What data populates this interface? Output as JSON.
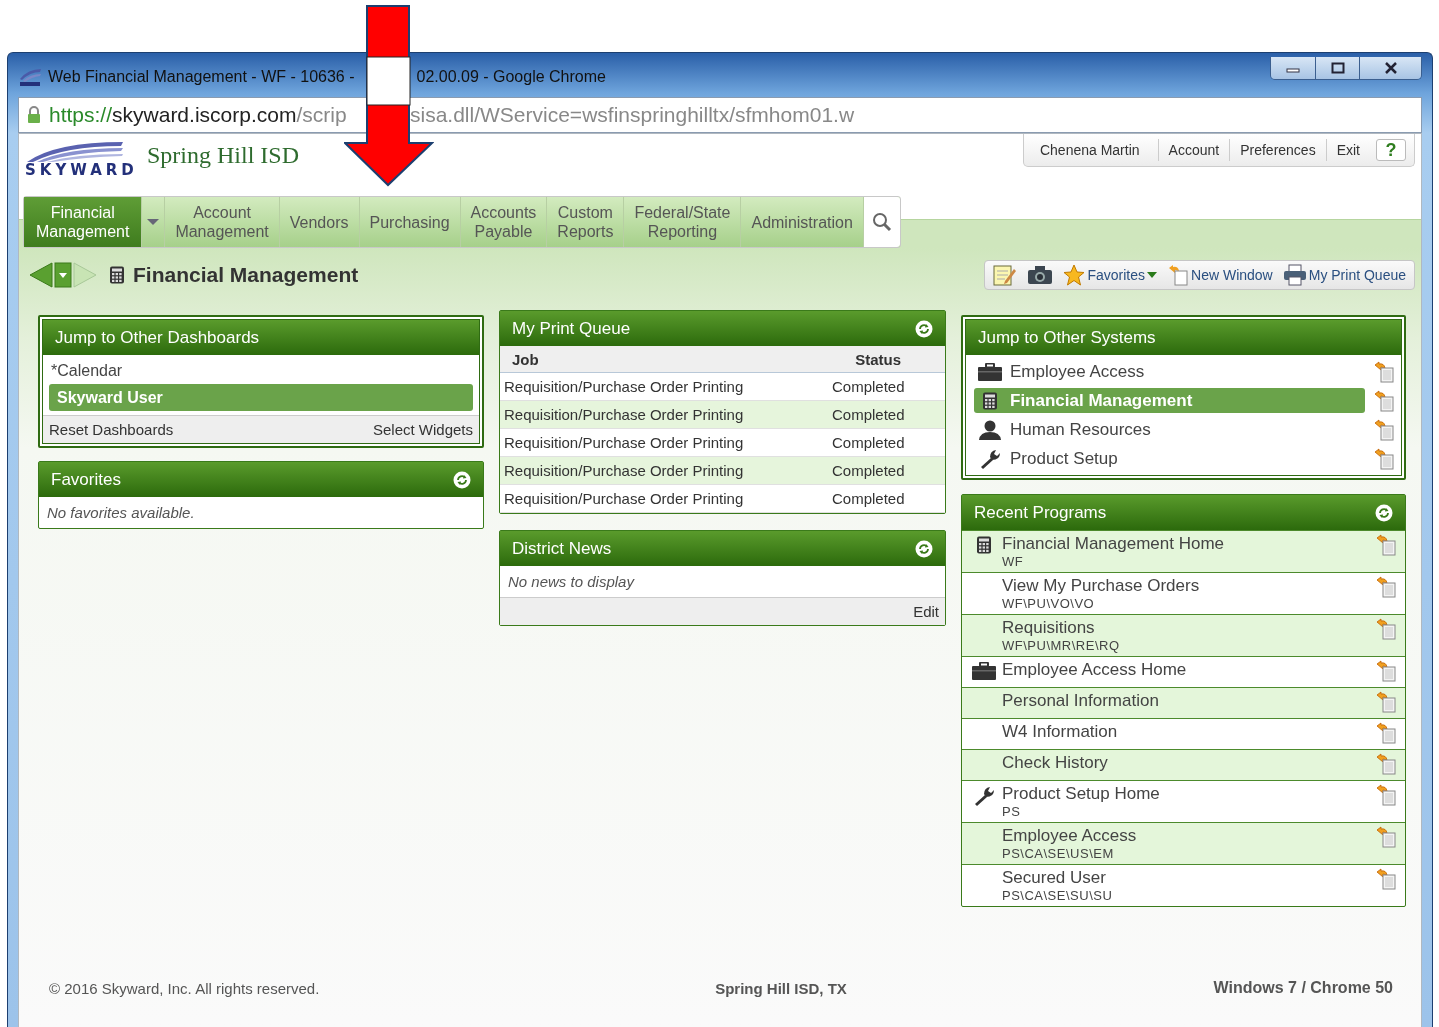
{
  "window": {
    "title_left": "Web Financial Management - WF - 10636 -",
    "title_right": "02.00.09 - Google Chrome",
    "url_scheme": "https://",
    "url_host": "skyward.iscorp.com",
    "url_path_left": "/scrip",
    "url_path_right": "sisa.dll/WService=wsfinspringhilltx/sfmhom01.w"
  },
  "header": {
    "logo_text": "SKYWARD",
    "district": "Spring Hill ISD",
    "user_links": [
      "Chenena Martin",
      "Account",
      "Preferences",
      "Exit"
    ],
    "help": "?"
  },
  "nav": {
    "tabs": [
      {
        "label": "Financial Management",
        "selected": true
      },
      {
        "label": "Account Management",
        "selected": false
      },
      {
        "label": "Vendors",
        "selected": false
      },
      {
        "label": "Purchasing",
        "selected": false
      },
      {
        "label": "Accounts Payable",
        "selected": false
      },
      {
        "label": "Custom Reports",
        "selected": false
      },
      {
        "label": "Federal/State Reporting",
        "selected": false
      },
      {
        "label": "Administration",
        "selected": false
      }
    ]
  },
  "page_title": "Financial Management",
  "toolbar": {
    "favorites": "Favorites",
    "new_window": "New Window",
    "print_queue": "My Print Queue"
  },
  "dashboards": {
    "title": "Jump to Other Dashboards",
    "items": [
      {
        "label": "*Calendar",
        "selected": false
      },
      {
        "label": "Skyward User",
        "selected": true
      }
    ],
    "reset": "Reset Dashboards",
    "select": "Select Widgets"
  },
  "favorites": {
    "title": "Favorites",
    "empty": "No favorites available."
  },
  "print_queue": {
    "title": "My Print Queue",
    "columns": [
      "Job",
      "Status"
    ],
    "rows": [
      {
        "job": "Requisition/Purchase Order Printing",
        "status": "Completed"
      },
      {
        "job": "Requisition/Purchase Order Printing",
        "status": "Completed"
      },
      {
        "job": "Requisition/Purchase Order Printing",
        "status": "Completed"
      },
      {
        "job": "Requisition/Purchase Order Printing",
        "status": "Completed"
      },
      {
        "job": "Requisition/Purchase Order Printing",
        "status": "Completed"
      }
    ]
  },
  "news": {
    "title": "District News",
    "empty": "No news to display",
    "edit": "Edit"
  },
  "systems": {
    "title": "Jump to Other Systems",
    "items": [
      {
        "label": "Employee Access",
        "kind": "briefcase",
        "selected": false
      },
      {
        "label": "Financial Management",
        "kind": "calculator",
        "selected": true
      },
      {
        "label": "Human Resources",
        "kind": "person",
        "selected": false
      },
      {
        "label": "Product Setup",
        "kind": "wrench",
        "selected": false
      }
    ]
  },
  "recent": {
    "title": "Recent Programs",
    "items": [
      {
        "name": "Financial Management Home",
        "path": "WF",
        "kind": "calculator"
      },
      {
        "name": "View My Purchase Orders",
        "path": "WF\\PU\\VO\\VO"
      },
      {
        "name": "Requisitions",
        "path": "WF\\PU\\MR\\RE\\RQ"
      },
      {
        "name": "Employee Access Home",
        "kind": "briefcase"
      },
      {
        "name": "Personal Information"
      },
      {
        "name": "W4 Information"
      },
      {
        "name": "Check History"
      },
      {
        "name": "Product Setup Home",
        "path": "PS",
        "kind": "wrench"
      },
      {
        "name": "Employee Access",
        "path": "PS\\CA\\SE\\US\\EM"
      },
      {
        "name": "Secured User",
        "path": "PS\\CA\\SE\\SU\\SU"
      }
    ]
  },
  "footer": {
    "copyright": "© 2016 Skyward, Inc. All rights reserved.",
    "district": "Spring Hill ISD, TX",
    "platform": "Windows 7 / Chrome 50"
  }
}
